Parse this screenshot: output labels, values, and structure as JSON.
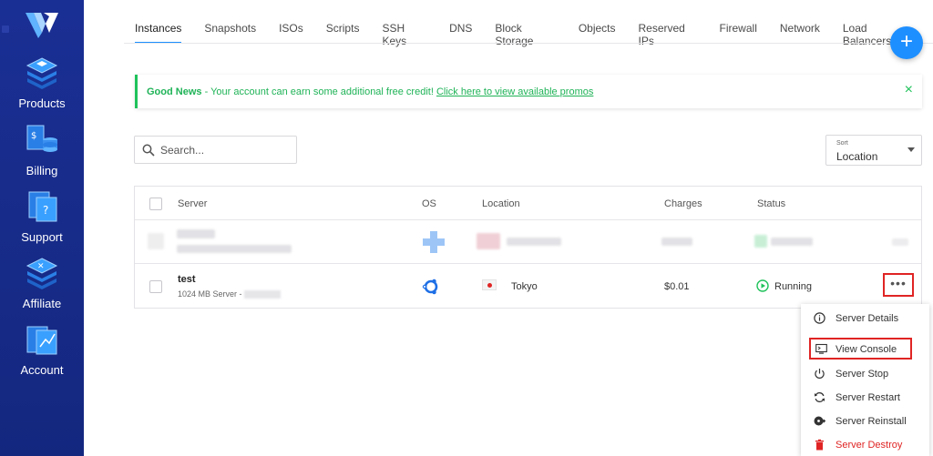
{
  "sidebar": {
    "items": [
      {
        "label": "Products",
        "icon": "layers-icon"
      },
      {
        "label": "Billing",
        "icon": "billing-icon"
      },
      {
        "label": "Support",
        "icon": "support-icon"
      },
      {
        "label": "Affiliate",
        "icon": "affiliate-icon"
      },
      {
        "label": "Account",
        "icon": "account-icon"
      }
    ]
  },
  "tabs": [
    {
      "label": "Instances",
      "active": true
    },
    {
      "label": "Snapshots"
    },
    {
      "label": "ISOs"
    },
    {
      "label": "Scripts"
    },
    {
      "label": "SSH Keys"
    },
    {
      "label": "DNS"
    },
    {
      "label": "Block Storage"
    },
    {
      "label": "Objects"
    },
    {
      "label": "Reserved IPs"
    },
    {
      "label": "Firewall"
    },
    {
      "label": "Network"
    },
    {
      "label": "Load Balancers"
    }
  ],
  "fab_label": "+",
  "promo": {
    "title": "Good News",
    "text": " - Your account can earn some additional free credit! ",
    "link": "Click here to view available promos",
    "close": "×"
  },
  "search": {
    "placeholder": "Search..."
  },
  "sort": {
    "label": "Sort",
    "value": "Location"
  },
  "table": {
    "headers": {
      "server": "Server",
      "os": "OS",
      "location": "Location",
      "charges": "Charges",
      "status": "Status"
    },
    "row": {
      "name": "test",
      "subtitle": "1024 MB Server - ",
      "location": "Tokyo",
      "charges": "$0.01",
      "status": "Running",
      "more": "•••"
    }
  },
  "menu": [
    {
      "label": "Server Details",
      "icon": "info-icon"
    },
    {
      "label": "View Console",
      "icon": "console-icon"
    },
    {
      "label": "Server Stop",
      "icon": "power-icon"
    },
    {
      "label": "Server Restart",
      "icon": "restart-icon"
    },
    {
      "label": "Server Reinstall",
      "icon": "reinstall-icon"
    },
    {
      "label": "Server Destroy",
      "icon": "trash-icon"
    }
  ],
  "colors": {
    "sidebar": "#1a2f94",
    "accent": "#1e8fff",
    "success": "#1fc25a",
    "danger": "#e02424"
  }
}
